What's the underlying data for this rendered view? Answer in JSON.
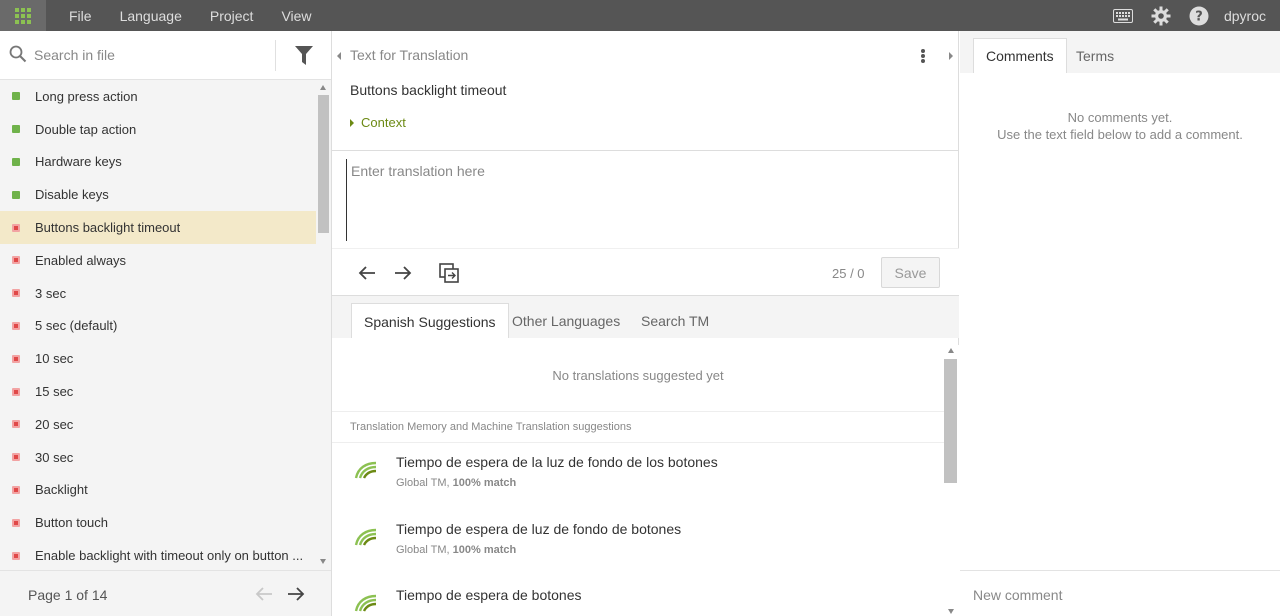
{
  "topbar": {
    "menu": [
      "File",
      "Language",
      "Project",
      "View"
    ],
    "user": "dpyroc",
    "colors": {
      "bar": "#555555",
      "accent": "#8cc152"
    }
  },
  "left": {
    "search_placeholder": "Search in file",
    "strings": [
      {
        "label": "Long press action",
        "status": "done"
      },
      {
        "label": "Double tap action",
        "status": "done"
      },
      {
        "label": "Hardware keys",
        "status": "done"
      },
      {
        "label": "Disable keys",
        "status": "done"
      },
      {
        "label": "Buttons backlight timeout",
        "status": "todo",
        "active": true
      },
      {
        "label": "Enabled always",
        "status": "todo"
      },
      {
        "label": "3 sec",
        "status": "todo"
      },
      {
        "label": "5 sec (default)",
        "status": "todo"
      },
      {
        "label": "10 sec",
        "status": "todo"
      },
      {
        "label": "15 sec",
        "status": "todo"
      },
      {
        "label": "20 sec",
        "status": "todo"
      },
      {
        "label": "30 sec",
        "status": "todo"
      },
      {
        "label": "Backlight",
        "status": "todo"
      },
      {
        "label": "Button touch",
        "status": "todo"
      },
      {
        "label": "Enable backlight with timeout only on button ...",
        "status": "todo"
      }
    ],
    "page_label": "Page 1 of 14"
  },
  "editor": {
    "section_title": "Text for Translation",
    "source_text": "Buttons backlight timeout",
    "context_label": "Context",
    "translation_placeholder": "Enter translation here",
    "counter": "25 / 0",
    "save_label": "Save"
  },
  "suggestions": {
    "tabs": [
      "Spanish Suggestions",
      "Other Languages",
      "Search TM"
    ],
    "empty_text": "No translations suggested yet",
    "tm_header": "Translation Memory and Machine Translation suggestions",
    "items": [
      {
        "text": "Tiempo de espera de la luz de fondo de los botones",
        "source": "Global TM, ",
        "match": "100% match"
      },
      {
        "text": "Tiempo de espera de luz de fondo de botones",
        "source": "Global TM, ",
        "match": "100% match"
      },
      {
        "text": "Tiempo de espera de botones",
        "source": "",
        "match": ""
      }
    ]
  },
  "right": {
    "tabs": [
      "Comments",
      "Terms"
    ],
    "no_comments_line1": "No comments yet.",
    "no_comments_line2": "Use the text field below to add a comment.",
    "comment_placeholder": "New comment"
  }
}
